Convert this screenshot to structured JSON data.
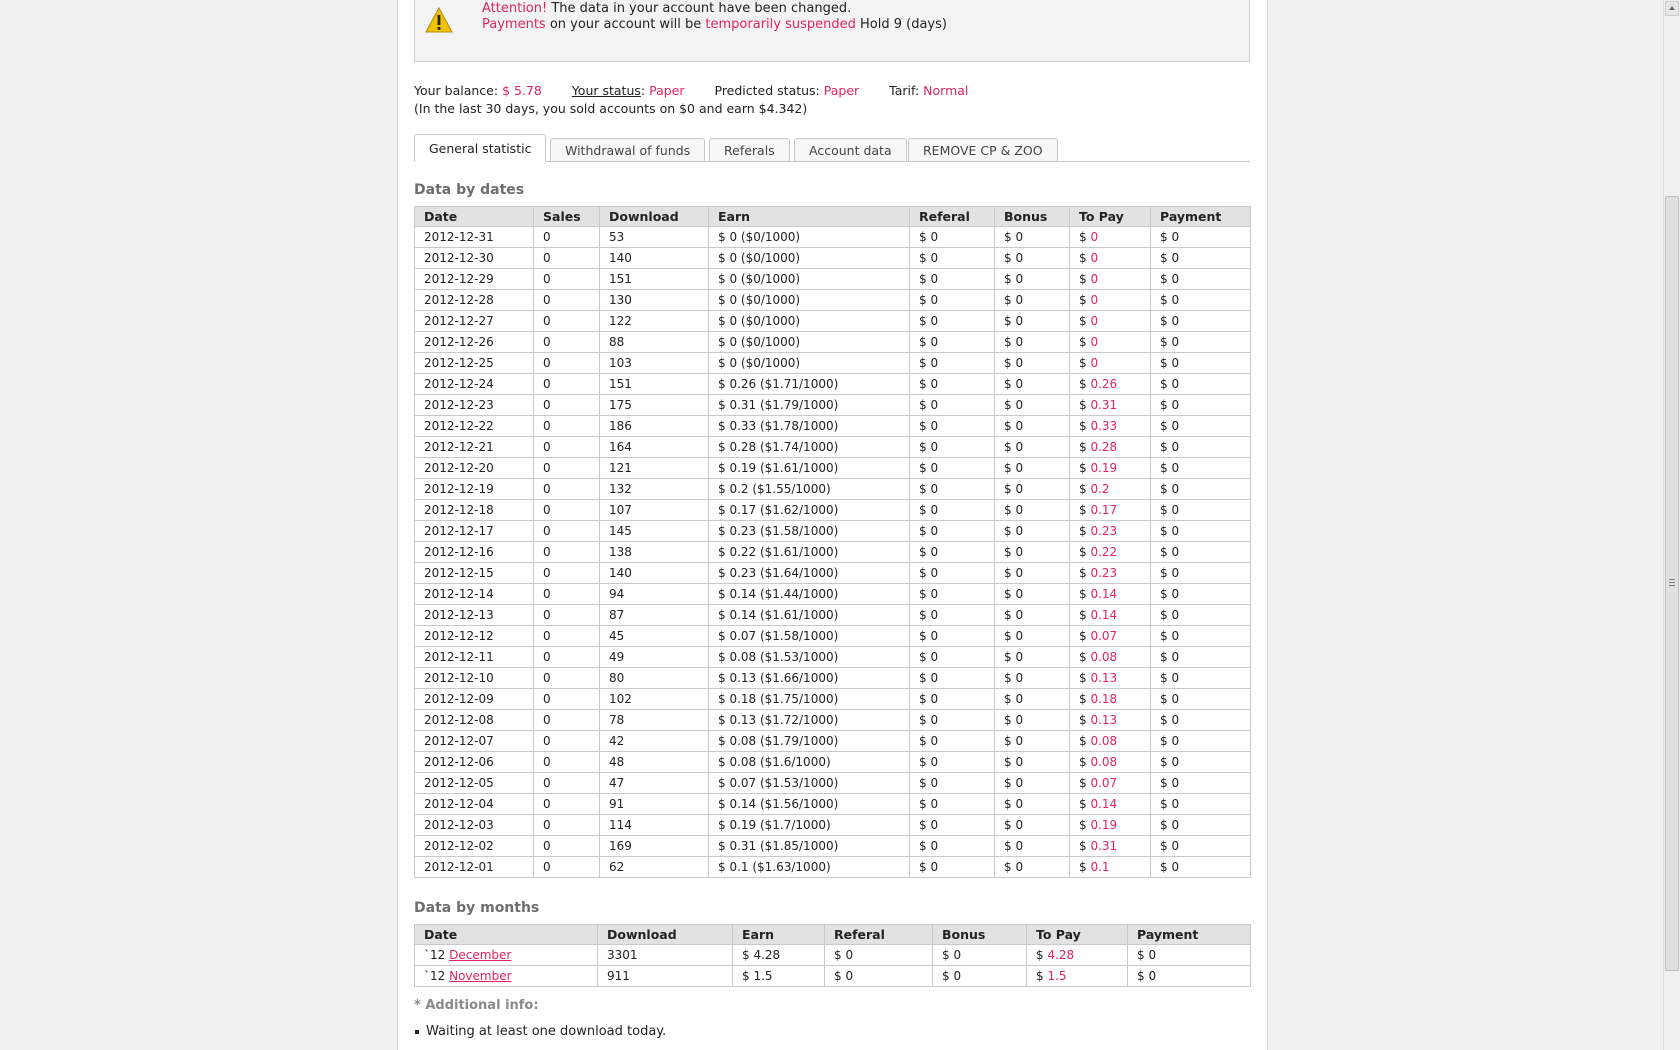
{
  "alert": {
    "attention_label": "Attention!",
    "attention_text": " The data in your account have been changed.",
    "payments_label": "Payments",
    "payments_mid": " on your account will be ",
    "suspended_label": "temporarily suspended",
    "hold_text": " Hold 9 (days)"
  },
  "status": {
    "balance_label": "Your balance:",
    "balance_value": "$ 5.78",
    "status_label": "Your status",
    "status_colon": ":",
    "status_value": "Paper",
    "predicted_label": "Predicted status:",
    "predicted_value": "Paper",
    "tarif_label": "Tarif:",
    "tarif_value": "Normal",
    "note": "(In the last 30 days, you sold accounts on $0 and earn $4.342)"
  },
  "tabs": [
    {
      "label": "General statistic"
    },
    {
      "label": "Withdrawal of funds"
    },
    {
      "label": "Referals"
    },
    {
      "label": "Account data"
    },
    {
      "label": "REMOVE CP & ZOO"
    }
  ],
  "dates_section": {
    "title": "Data by dates",
    "headers": [
      "Date",
      "Sales",
      "Download",
      "Earn",
      "Referal",
      "Bonus",
      "To Pay",
      "Payment"
    ],
    "rows": [
      [
        "2012-12-31",
        "0",
        "53",
        "$ 0 ($0/1000)",
        "$ 0",
        "$ 0",
        "0",
        "$ 0"
      ],
      [
        "2012-12-30",
        "0",
        "140",
        "$ 0 ($0/1000)",
        "$ 0",
        "$ 0",
        "0",
        "$ 0"
      ],
      [
        "2012-12-29",
        "0",
        "151",
        "$ 0 ($0/1000)",
        "$ 0",
        "$ 0",
        "0",
        "$ 0"
      ],
      [
        "2012-12-28",
        "0",
        "130",
        "$ 0 ($0/1000)",
        "$ 0",
        "$ 0",
        "0",
        "$ 0"
      ],
      [
        "2012-12-27",
        "0",
        "122",
        "$ 0 ($0/1000)",
        "$ 0",
        "$ 0",
        "0",
        "$ 0"
      ],
      [
        "2012-12-26",
        "0",
        "88",
        "$ 0 ($0/1000)",
        "$ 0",
        "$ 0",
        "0",
        "$ 0"
      ],
      [
        "2012-12-25",
        "0",
        "103",
        "$ 0 ($0/1000)",
        "$ 0",
        "$ 0",
        "0",
        "$ 0"
      ],
      [
        "2012-12-24",
        "0",
        "151",
        "$ 0.26 ($1.71/1000)",
        "$ 0",
        "$ 0",
        "0.26",
        "$ 0"
      ],
      [
        "2012-12-23",
        "0",
        "175",
        "$ 0.31 ($1.79/1000)",
        "$ 0",
        "$ 0",
        "0.31",
        "$ 0"
      ],
      [
        "2012-12-22",
        "0",
        "186",
        "$ 0.33 ($1.78/1000)",
        "$ 0",
        "$ 0",
        "0.33",
        "$ 0"
      ],
      [
        "2012-12-21",
        "0",
        "164",
        "$ 0.28 ($1.74/1000)",
        "$ 0",
        "$ 0",
        "0.28",
        "$ 0"
      ],
      [
        "2012-12-20",
        "0",
        "121",
        "$ 0.19 ($1.61/1000)",
        "$ 0",
        "$ 0",
        "0.19",
        "$ 0"
      ],
      [
        "2012-12-19",
        "0",
        "132",
        "$ 0.2 ($1.55/1000)",
        "$ 0",
        "$ 0",
        "0.2",
        "$ 0"
      ],
      [
        "2012-12-18",
        "0",
        "107",
        "$ 0.17 ($1.62/1000)",
        "$ 0",
        "$ 0",
        "0.17",
        "$ 0"
      ],
      [
        "2012-12-17",
        "0",
        "145",
        "$ 0.23 ($1.58/1000)",
        "$ 0",
        "$ 0",
        "0.23",
        "$ 0"
      ],
      [
        "2012-12-16",
        "0",
        "138",
        "$ 0.22 ($1.61/1000)",
        "$ 0",
        "$ 0",
        "0.22",
        "$ 0"
      ],
      [
        "2012-12-15",
        "0",
        "140",
        "$ 0.23 ($1.64/1000)",
        "$ 0",
        "$ 0",
        "0.23",
        "$ 0"
      ],
      [
        "2012-12-14",
        "0",
        "94",
        "$ 0.14 ($1.44/1000)",
        "$ 0",
        "$ 0",
        "0.14",
        "$ 0"
      ],
      [
        "2012-12-13",
        "0",
        "87",
        "$ 0.14 ($1.61/1000)",
        "$ 0",
        "$ 0",
        "0.14",
        "$ 0"
      ],
      [
        "2012-12-12",
        "0",
        "45",
        "$ 0.07 ($1.58/1000)",
        "$ 0",
        "$ 0",
        "0.07",
        "$ 0"
      ],
      [
        "2012-12-11",
        "0",
        "49",
        "$ 0.08 ($1.53/1000)",
        "$ 0",
        "$ 0",
        "0.08",
        "$ 0"
      ],
      [
        "2012-12-10",
        "0",
        "80",
        "$ 0.13 ($1.66/1000)",
        "$ 0",
        "$ 0",
        "0.13",
        "$ 0"
      ],
      [
        "2012-12-09",
        "0",
        "102",
        "$ 0.18 ($1.75/1000)",
        "$ 0",
        "$ 0",
        "0.18",
        "$ 0"
      ],
      [
        "2012-12-08",
        "0",
        "78",
        "$ 0.13 ($1.72/1000)",
        "$ 0",
        "$ 0",
        "0.13",
        "$ 0"
      ],
      [
        "2012-12-07",
        "0",
        "42",
        "$ 0.08 ($1.79/1000)",
        "$ 0",
        "$ 0",
        "0.08",
        "$ 0"
      ],
      [
        "2012-12-06",
        "0",
        "48",
        "$ 0.08 ($1.6/1000)",
        "$ 0",
        "$ 0",
        "0.08",
        "$ 0"
      ],
      [
        "2012-12-05",
        "0",
        "47",
        "$ 0.07 ($1.53/1000)",
        "$ 0",
        "$ 0",
        "0.07",
        "$ 0"
      ],
      [
        "2012-12-04",
        "0",
        "91",
        "$ 0.14 ($1.56/1000)",
        "$ 0",
        "$ 0",
        "0.14",
        "$ 0"
      ],
      [
        "2012-12-03",
        "0",
        "114",
        "$ 0.19 ($1.7/1000)",
        "$ 0",
        "$ 0",
        "0.19",
        "$ 0"
      ],
      [
        "2012-12-02",
        "0",
        "169",
        "$ 0.31 ($1.85/1000)",
        "$ 0",
        "$ 0",
        "0.31",
        "$ 0"
      ],
      [
        "2012-12-01",
        "0",
        "62",
        "$ 0.1 ($1.63/1000)",
        "$ 0",
        "$ 0",
        "0.1",
        "$ 0"
      ]
    ],
    "to_pay_prefix": "$ "
  },
  "months_section": {
    "title": "Data by months",
    "headers": [
      "Date",
      "Download",
      "Earn",
      "Referal",
      "Bonus",
      "To Pay",
      "Payment"
    ],
    "rows": [
      {
        "year": "`12 ",
        "month": "December",
        "download": "3301",
        "earn": "$ 4.28",
        "referal": "$ 0",
        "bonus": "$ 0",
        "to_pay": "4.28",
        "payment": "$ 0"
      },
      {
        "year": "`12 ",
        "month": "November",
        "download": "911",
        "earn": "$ 1.5",
        "referal": "$ 0",
        "bonus": "$ 0",
        "to_pay": "1.5",
        "payment": "$ 0"
      }
    ]
  },
  "additional": {
    "title": "* Additional info:",
    "items": [
      "Waiting at least one download today."
    ]
  },
  "colors": {
    "accent": "#e0245e",
    "header_bg": "#e2e2e2",
    "border": "#c9c9c9"
  }
}
